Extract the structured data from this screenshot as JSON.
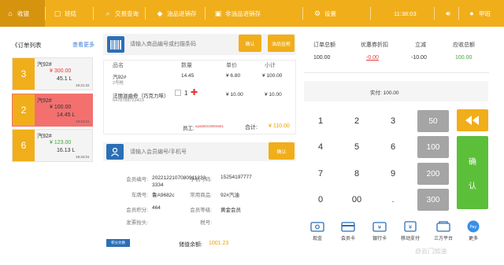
{
  "nav": {
    "cashier": "收银",
    "shift": "班结",
    "transactions": "交易查询",
    "oil_stock": "油品进销存",
    "nonoil_stock": "非油品进销存",
    "settings": "设置",
    "time": "11:38:03",
    "user": "甲班"
  },
  "orders": {
    "title": "《订单列表",
    "view_more": "查看更多",
    "items": [
      {
        "num": "3",
        "name": "汽92#",
        "price": "¥  300.00",
        "liters": "45.1 L",
        "time": "19:21:22",
        "price_color": "#e23b3b"
      },
      {
        "num": "2",
        "name": "汽92#",
        "price": "¥  100.00",
        "liters": "14.45 L",
        "time": "19:34:01",
        "price_color": "#333333"
      },
      {
        "num": "6",
        "name": "汽92#",
        "price": "¥  123.00",
        "liters": "16.13 L",
        "time": "19:34:01",
        "price_color": "#3aa63a"
      }
    ]
  },
  "scan": {
    "placeholder": "请输入商品编号或扫描条码",
    "confirm": "确认",
    "refuel": "油品挂枪"
  },
  "goods": {
    "headers": [
      "品名",
      "数量",
      "单价",
      "小计"
    ],
    "rows": [
      {
        "name": "汽92#",
        "sub": "2号枪",
        "qty": "14.45",
        "price": "¥ 6.80",
        "subtotal": "¥ 100.00"
      },
      {
        "name": "法丽滋曲奇（巧克力味）",
        "sub": "6478788723423",
        "qty": "1",
        "price": "¥ 10.00",
        "subtotal": "¥ 10.00"
      }
    ],
    "cashier_label": "员工:",
    "cashier_value": "epai55310904561",
    "total_label": "合计:",
    "total_value": "¥  110.00"
  },
  "member": {
    "placeholder": "请输入会员编号/手机号",
    "confirm": "确认",
    "fields": {
      "member_no_label": "会员编号:",
      "member_no": "2022122107080911223 3334",
      "phone_label": "手机号码:",
      "phone": "15254197777",
      "plate_label": "车牌号:",
      "plate": "鲁A9682c",
      "fav_label": "常用商品:",
      "fav": "92#汽油",
      "points_label": "会员积分:",
      "points": "464",
      "level_label": "会员等级:",
      "level": "黄金会员",
      "invoice_label": "发票抬头:",
      "invoice": "",
      "tax_label": "税号:",
      "tax": ""
    },
    "points_tag": "积分兑换",
    "balance_label": "储值余额:",
    "balance": "1001.23"
  },
  "summary": {
    "headers": [
      "订单总额",
      "优惠券折扣",
      "立减",
      "应收总额"
    ],
    "values": [
      "100.00",
      "-0.00",
      "-10.00",
      "100.00"
    ],
    "paid_label": "实付:  100.00"
  },
  "keypad": {
    "digits": [
      "1",
      "2",
      "3",
      "4",
      "5",
      "6",
      "7",
      "8",
      "9",
      "0",
      "00",
      "."
    ],
    "quick": [
      "50",
      "100",
      "200",
      "300"
    ],
    "confirm_1": "确",
    "confirm_2": "认"
  },
  "payments": [
    {
      "label": "现金",
      "icon": "cash-icon"
    },
    {
      "label": "会员卡",
      "icon": "member-card-icon"
    },
    {
      "label": "银行卡",
      "icon": "bank-card-icon"
    },
    {
      "label": "移动支付",
      "icon": "mobile-pay-icon"
    },
    {
      "label": "三方平台",
      "icon": "third-party-icon"
    },
    {
      "label": "更多",
      "icon": "more-pay-icon"
    }
  ],
  "watermark": "@云门加油",
  "colors": {
    "accent": "#f1ae1b",
    "blue": "#2b6fb6",
    "green": "#5cbf3a",
    "selected_order": "#f3706f"
  }
}
